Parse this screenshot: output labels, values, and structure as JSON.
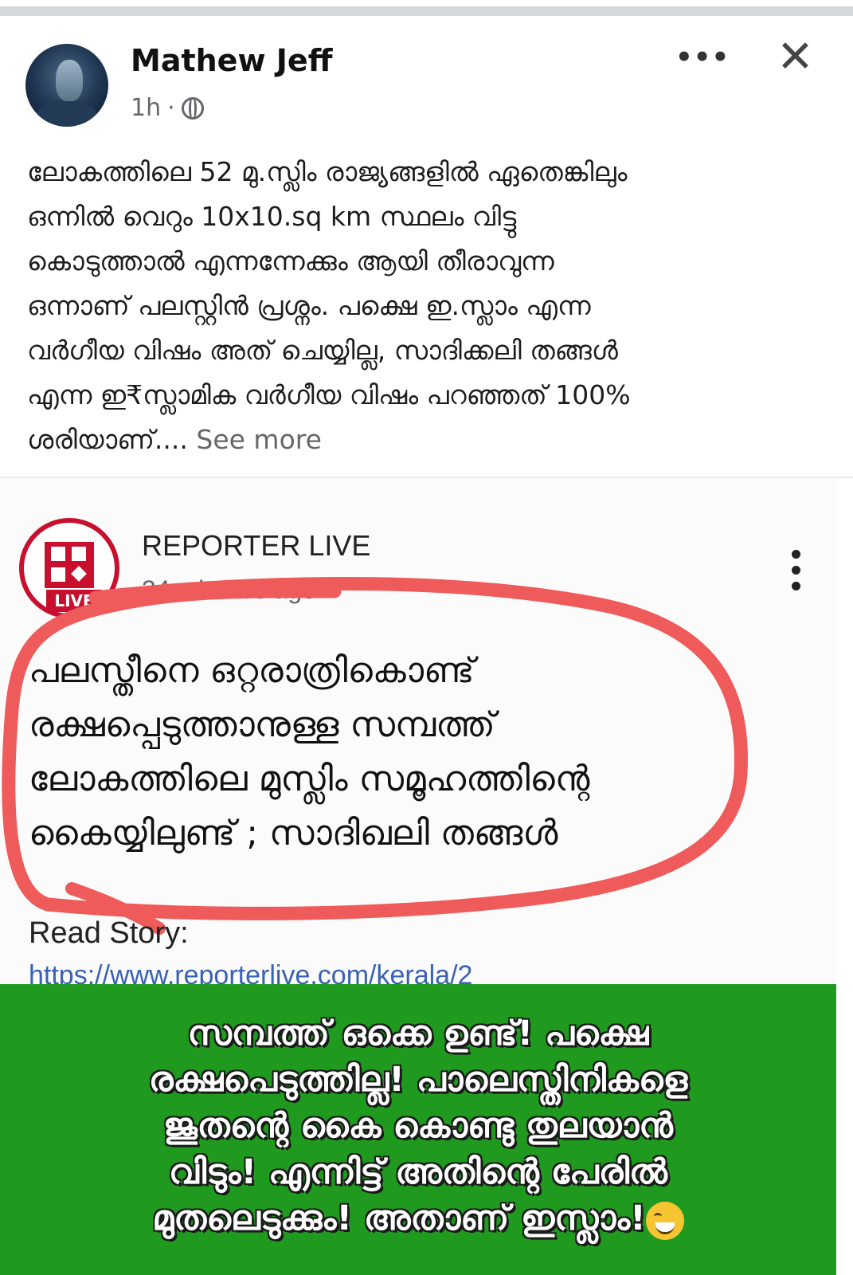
{
  "post": {
    "author": "Mathew Jeff",
    "time": "1h",
    "dot": "·",
    "more_icon": "•••",
    "close_icon": "✕",
    "text": "ലോകത്തിലെ 52 മു.സ്ലിം രാജ്യങ്ങളിൽ ഏതെങ്കിലും\nഒന്നിൽ വെറും 10x10.sq km സ്ഥലം വിട്ടു\nകൊടുത്താൽ എന്നന്നേക്കും ആയി തീരാവുന്ന\nഒന്നാണ് പലസ്റ്റിൻ പ്രശ്നം. പക്ഷെ ഇ.സ്ലാം എന്ന\nവർഗീയ വിഷം അത് ചെയ്യില്ല, സാദിക്കലി തങ്ങൾ\nഎന്ന ഇ₹സ്ലാമിക വർഗീയ വിഷം പറഞ്ഞത് 100%\nശരിയാണ്....",
    "see_more": "See more"
  },
  "shared": {
    "source": "REPORTER LIVE",
    "logo_badge": "LIVE",
    "time": "34 minutes ago",
    "headline": "പലസ്തീനെ ഒറ്റരാത്രികൊണ്ട്\nരക്ഷപ്പെടുത്താനുള്ള സമ്പത്ത്\nലോകത്തിലെ മുസ്ലിം സമൂഹത്തിന്റെ\nകൈയ്യിലുണ്ട് ; സാദിഖലി തങ്ങൾ",
    "read_story": "Read Story:",
    "link": "https://www.reporterlive.com/kerala/2"
  },
  "banner": {
    "text": "സമ്പത്ത് ഒക്കെ ഉണ്ട്! പക്ഷെ\nരക്ഷപെടുത്തില്ല! പാലെസ്തിനികളെ\nജൂതന്റെ കൈ കൊണ്ടു തുലയാൻ\nവിടും! എന്നിട്ട് അതിന്റെ പേരിൽ\nമുതലെടുക്കും! അതാണ് ഇസ്ലാം!",
    "emoji": "grinning-face-icon"
  },
  "colors": {
    "annotation_circle": "#ef5a5a",
    "banner_bg": "#1f9a1f",
    "brand_red": "#c8102e"
  }
}
